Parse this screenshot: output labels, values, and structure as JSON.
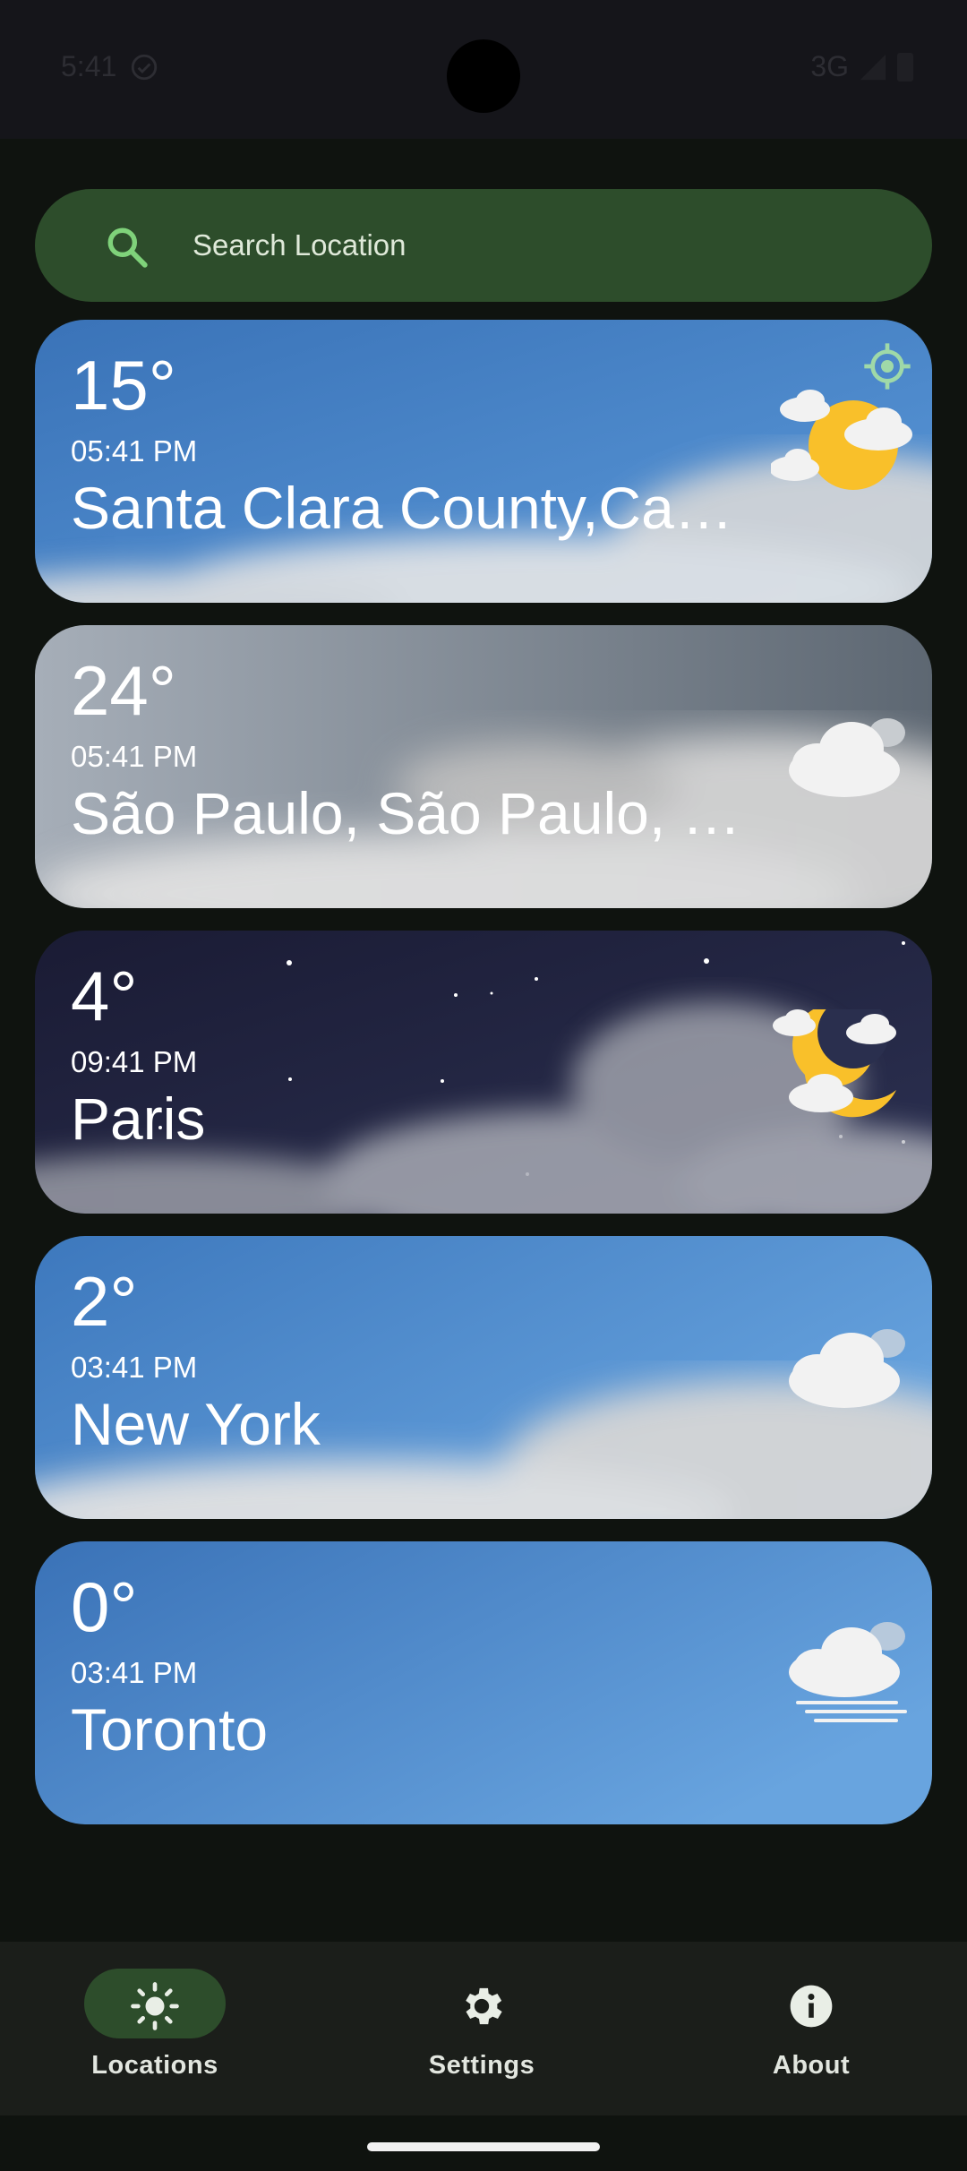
{
  "status_bar": {
    "time": "5:41",
    "network": "3G"
  },
  "search": {
    "placeholder": "Search Location"
  },
  "locations": [
    {
      "temp": "15°",
      "time": "05:41 PM",
      "city": "Santa Clara County,Ca…",
      "condition": "partly-cloudy-day",
      "current": true
    },
    {
      "temp": "24°",
      "time": "05:41 PM",
      "city": "São Paulo, São Paulo, …",
      "condition": "cloudy",
      "current": false
    },
    {
      "temp": "4°",
      "time": "09:41 PM",
      "city": "Paris",
      "condition": "partly-cloudy-night",
      "current": false
    },
    {
      "temp": "2°",
      "time": "03:41 PM",
      "city": "New York",
      "condition": "cloudy",
      "current": false
    },
    {
      "temp": "0°",
      "time": "03:41 PM",
      "city": "Toronto",
      "condition": "fog",
      "current": false
    }
  ],
  "nav": {
    "items": [
      {
        "label": "Locations",
        "icon": "sun-icon",
        "active": true
      },
      {
        "label": "Settings",
        "icon": "gear-icon",
        "active": false
      },
      {
        "label": "About",
        "icon": "info-icon",
        "active": false
      }
    ]
  },
  "colors": {
    "background": "#0f130f",
    "accent_green": "#2d4d2b",
    "search_icon_green": "#7fd27a",
    "sun_yellow": "#f9c02a"
  }
}
